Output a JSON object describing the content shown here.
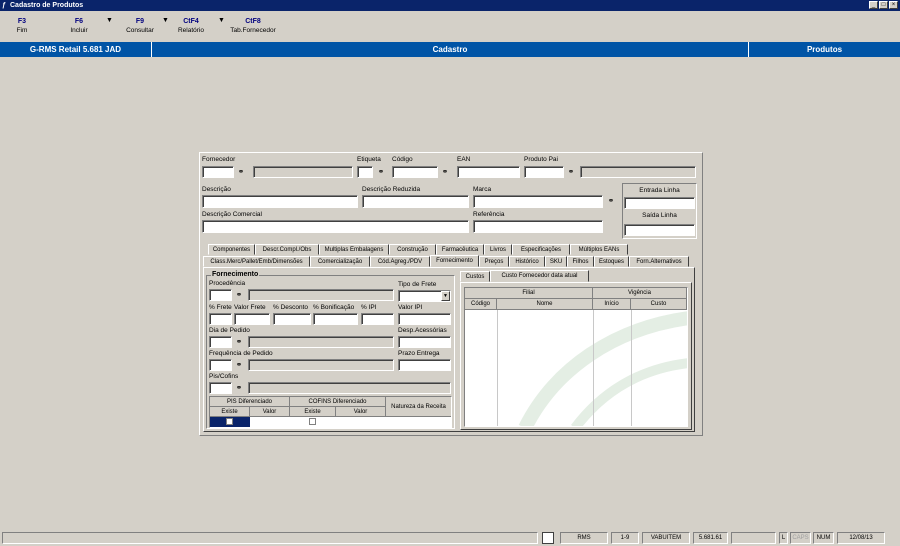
{
  "window": {
    "title": "Cadastro de Produtos",
    "controls": [
      "_",
      "□",
      "×"
    ]
  },
  "toolbar": [
    {
      "key": "F3",
      "label": "Fim"
    },
    {
      "key": "F6",
      "label": "Incluir"
    },
    {
      "key": "F9",
      "label": "Consultar"
    },
    {
      "key": "CtF4",
      "label": "Relatório"
    },
    {
      "key": "CtF8",
      "label": "Tab.Fornecedor"
    }
  ],
  "header": {
    "app": "G-RMS Retail 5.681 JAD",
    "center": "Cadastro",
    "right": "Produtos"
  },
  "form": {
    "fornecedor": "Fornecedor",
    "etiqueta": "Etiqueta",
    "codigo": "Código",
    "ean": "EAN",
    "produto_pai": "Produto Pai",
    "descricao": "Descrição",
    "descricao_reduzida": "Descrição Reduzida",
    "marca": "Marca",
    "descricao_comercial": "Descrição Comercial",
    "referencia": "Referência",
    "entrada_linha": "Entrada Linha",
    "saida_linha": "Saída Linha"
  },
  "tabs_row1": [
    "Componentes",
    "Descr.Compl./Obs",
    "Multiplas Embalagens",
    "Construção",
    "Farmacêutica",
    "Livros",
    "Especificações",
    "Múltiplos EANs"
  ],
  "tabs_row2": [
    "Class.Merc/Pallet/Emb/Dimensões",
    "Comercialização",
    "Cód.Agreg./PDV",
    "Fornecimento",
    "Preços",
    "Histórico",
    "SKU",
    "Filhos",
    "Estoques",
    "Forn.Alternativos"
  ],
  "fornecimento": {
    "group_title": "Fornecimento",
    "procedencia": "Procedência",
    "tipo_frete": "Tipo de Frete",
    "pct_frete": "% Frete",
    "valor_frete": "Valor Frete",
    "pct_desconto": "% Desconto",
    "pct_bonificacao": "% Bonificação",
    "pct_ipi": "% IPI",
    "valor_ipi": "Valor IPI",
    "dia_pedido": "Dia de Pedido",
    "desp_acessorias": "Desp.Acessórias",
    "frequencia_pedido": "Frequência de Pedido",
    "prazo_entrega": "Prazo Entrega",
    "pis_cofins": "Pis/Cofins",
    "pis_dif": "PIS Diferenciado",
    "cofins_dif": "COFINS Diferenciado",
    "natureza_receita": "Natureza da Receita",
    "existe": "Existe",
    "valor": "Valor"
  },
  "custos": {
    "tabs": [
      "Custos",
      "Custo Fornecedor data atual"
    ],
    "filial": "Filial",
    "vigencia": "Vigência",
    "codigo": "Código",
    "nome": "Nome",
    "inicio": "Início",
    "custo": "Custo"
  },
  "status": {
    "rms": "RMS",
    "range": "1-9",
    "user": "VABUITEM",
    "version": "5.681.61",
    "l": "L",
    "caps": "CAPS",
    "num": "NUM",
    "date": "12/08/13"
  }
}
